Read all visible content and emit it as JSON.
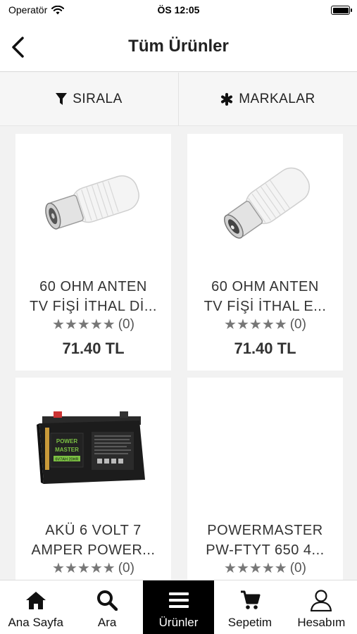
{
  "status_bar": {
    "carrier": "Operatör",
    "time": "ÖS 12:05"
  },
  "nav": {
    "title": "Tüm Ürünler"
  },
  "filters": {
    "sort_label": "SIRALA",
    "brands_label": "MARKALAR"
  },
  "products": [
    {
      "name_line1": "60 OHM ANTEN",
      "name_line2": "TV FİŞİ İTHAL Dİ...",
      "rating_count": "(0)",
      "price": "71.40 TL",
      "stars": "★★★★★",
      "image": "antenna-connector-female"
    },
    {
      "name_line1": "60 OHM ANTEN",
      "name_line2": "TV FİŞİ İTHAL E...",
      "rating_count": "(0)",
      "price": "71.40 TL",
      "stars": "★★★★★",
      "image": "antenna-connector-male"
    },
    {
      "name_line1": "AKÜ 6 VOLT 7",
      "name_line2": "AMPER POWER...",
      "rating_count": "(0)",
      "price": "",
      "stars": "★★★★★",
      "image": "battery",
      "image_brand": "POWER MASTER",
      "image_model": "6V7AH 20HR"
    },
    {
      "name_line1": "POWERMASTER",
      "name_line2": "PW-FTYT 650 4...",
      "rating_count": "(0)",
      "price": "",
      "stars": "★★★★★",
      "image": "none"
    }
  ],
  "tabs": [
    {
      "label": "Ana Sayfa",
      "icon": "home-icon",
      "active": false
    },
    {
      "label": "Ara",
      "icon": "search-icon",
      "active": false
    },
    {
      "label": "Ürünler",
      "icon": "menu-icon",
      "active": true
    },
    {
      "label": "Sepetim",
      "icon": "cart-icon",
      "active": false
    },
    {
      "label": "Hesabım",
      "icon": "user-icon",
      "active": false
    }
  ],
  "colors": {
    "star": "#777777",
    "active_tab_bg": "#000000",
    "page_bg": "#f2f2f2"
  }
}
